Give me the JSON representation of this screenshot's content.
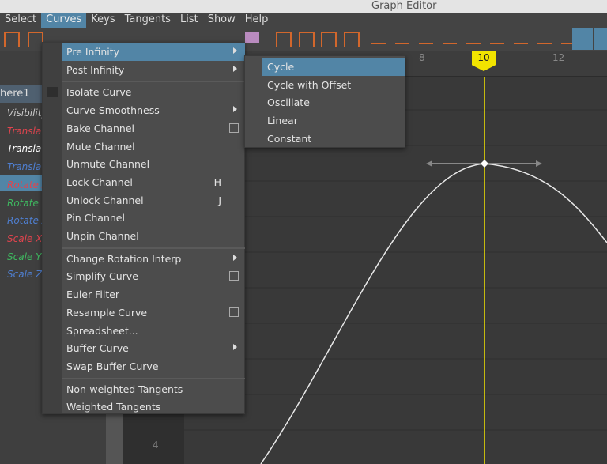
{
  "window": {
    "title": "Graph Editor"
  },
  "menubar": [
    "Select",
    "Curves",
    "Keys",
    "Tangents",
    "List",
    "Show",
    "Help"
  ],
  "outliner": {
    "object": "here1",
    "channels": [
      {
        "label": "Visibility",
        "color": "#c8c8c8"
      },
      {
        "label": "Translate X",
        "color": "#e0444e"
      },
      {
        "label": "Translate Y",
        "color": "#ffffff",
        "selected": true
      },
      {
        "label": "Translate Z",
        "color": "#4f7fd0"
      },
      {
        "label": "Rotate X",
        "color": "#e0444e"
      },
      {
        "label": "Rotate Y",
        "color": "#3fb860"
      },
      {
        "label": "Rotate Z",
        "color": "#4f7fd0"
      },
      {
        "label": "Scale X",
        "color": "#e0444e"
      },
      {
        "label": "Scale Y",
        "color": "#3fb860"
      },
      {
        "label": "Scale Z",
        "color": "#4f7fd0"
      }
    ]
  },
  "timeline": {
    "ticks": [
      "8",
      "12"
    ],
    "current_frame": "10"
  },
  "graph": {
    "value_label": "4"
  },
  "curves_menu": {
    "groups": [
      [
        {
          "label": "Pre Infinity",
          "submenu": true,
          "highlighted": true
        },
        {
          "label": "Post Infinity",
          "submenu": true
        }
      ],
      [
        {
          "label": "Isolate Curve"
        },
        {
          "label": "Curve Smoothness",
          "submenu": true
        },
        {
          "label": "Bake Channel",
          "option_box": true
        },
        {
          "label": "Mute Channel"
        },
        {
          "label": "Unmute Channel"
        },
        {
          "label": "Lock Channel",
          "shortcut": "H"
        },
        {
          "label": "Unlock Channel",
          "shortcut": "J"
        },
        {
          "label": "Pin Channel"
        },
        {
          "label": "Unpin Channel"
        }
      ],
      [
        {
          "label": "Change Rotation Interp",
          "submenu": true
        },
        {
          "label": "Simplify Curve",
          "option_box": true
        },
        {
          "label": "Euler Filter"
        },
        {
          "label": "Resample Curve",
          "option_box": true
        },
        {
          "label": "Spreadsheet..."
        },
        {
          "label": "Buffer Curve",
          "submenu": true
        },
        {
          "label": "Swap Buffer Curve"
        }
      ],
      [
        {
          "label": "Non-weighted Tangents"
        },
        {
          "label": "Weighted Tangents"
        }
      ]
    ]
  },
  "pre_infinity_submenu": [
    {
      "label": "Cycle",
      "highlighted": true
    },
    {
      "label": "Cycle with Offset"
    },
    {
      "label": "Oscillate"
    },
    {
      "label": "Linear"
    },
    {
      "label": "Constant"
    }
  ],
  "colors": {
    "accent": "#5285a6",
    "current_time": "#f2e400",
    "tool_icon": "#d2672c"
  }
}
